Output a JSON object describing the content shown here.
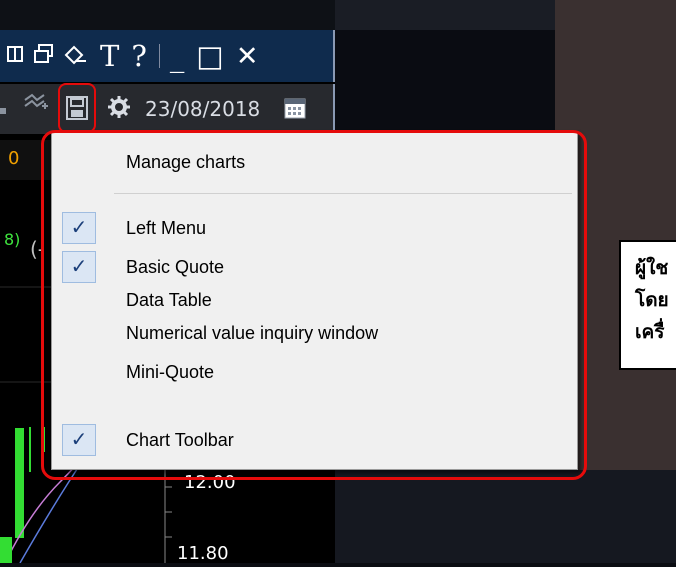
{
  "title_bar": {
    "restore_icon": "restore-window-icon",
    "cascade_icon": "cascade-window-icon",
    "draw_icon": "draw-pen-icon",
    "text_tool": "T",
    "help_tool": "?",
    "minimize": "_",
    "maximize": "□",
    "close": "✕"
  },
  "toolbar": {
    "date": "23/08/2018",
    "icons": [
      "chart-tool-icon",
      "save-icon",
      "gear-icon",
      "calendar-icon"
    ]
  },
  "chart": {
    "price_strip_value": "0",
    "legend_number": "8)",
    "legend_paren": "(-",
    "y_axis_labels": [
      "12.00",
      "11.80"
    ]
  },
  "menu": {
    "items": [
      {
        "label": "Manage charts",
        "checked": false
      },
      {
        "label": "Left Menu",
        "checked": true
      },
      {
        "label": "Basic Quote",
        "checked": true
      },
      {
        "label": "Data Table",
        "checked": false
      },
      {
        "label": "Numerical value inquiry window",
        "checked": false
      },
      {
        "label": "Mini-Quote",
        "checked": false
      },
      {
        "label": "Chart Toolbar",
        "checked": true
      }
    ],
    "check_glyph": "✓"
  },
  "tooltip": {
    "lines": [
      "ผู้ใช",
      "โดย",
      "เครื่"
    ]
  },
  "colors": {
    "highlight": "#e50b0b",
    "title_bar": "#0f2b4d",
    "menu_bg": "#f0f0f0",
    "check_bg": "#dbe6f4"
  }
}
